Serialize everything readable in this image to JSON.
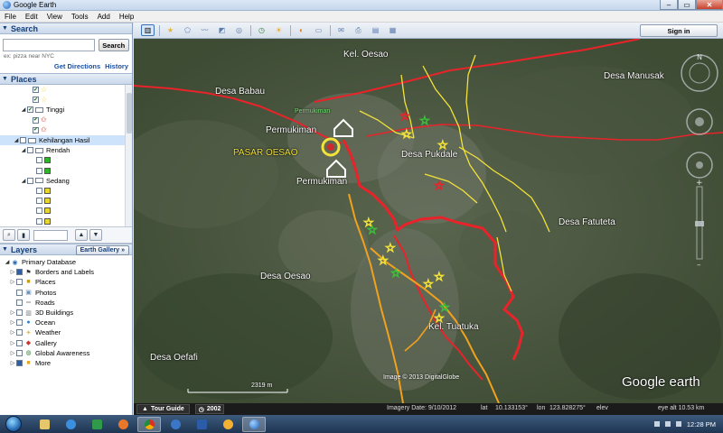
{
  "window": {
    "title": "Google Earth"
  },
  "menu": [
    "File",
    "Edit",
    "View",
    "Tools",
    "Add",
    "Help"
  ],
  "search": {
    "header": "Search",
    "placeholder": "",
    "button": "Search",
    "hint": "ex: pizza near NYC",
    "get_directions": "Get Directions",
    "history": "History"
  },
  "places": {
    "header": "Places",
    "items": [
      {
        "label": "",
        "indent": 2,
        "checked": true,
        "icon": "yellow-star-icon"
      },
      {
        "label": "",
        "indent": 2,
        "checked": true,
        "icon": "yellow-star-icon"
      },
      {
        "label": "Tinggi",
        "indent": 1,
        "checked": true,
        "icon": "folder-icon"
      },
      {
        "label": "",
        "indent": 2,
        "checked": true,
        "icon": "red-star-icon"
      },
      {
        "label": "",
        "indent": 2,
        "checked": true,
        "icon": "red-star-icon"
      },
      {
        "label": "Kehilangan Hasil",
        "indent": 0,
        "checked": false,
        "icon": "folder-icon",
        "selected": true
      },
      {
        "label": "Rendah",
        "indent": 1,
        "checked": false,
        "icon": "folder-icon"
      },
      {
        "label": "",
        "indent": 2,
        "checked": false,
        "icon": "green-square-icon"
      },
      {
        "label": "",
        "indent": 2,
        "checked": false,
        "icon": "green-square-icon"
      },
      {
        "label": "Sedang",
        "indent": 1,
        "checked": false,
        "icon": "folder-icon"
      },
      {
        "label": "",
        "indent": 2,
        "checked": false,
        "icon": "yellow-square-icon"
      },
      {
        "label": "",
        "indent": 2,
        "checked": false,
        "icon": "yellow-square-icon"
      },
      {
        "label": "",
        "indent": 2,
        "checked": false,
        "icon": "yellow-square-icon"
      },
      {
        "label": "",
        "indent": 2,
        "checked": false,
        "icon": "yellow-square-icon"
      }
    ]
  },
  "layers": {
    "header": "Layers",
    "gallery_button": "Earth Gallery",
    "items": [
      {
        "label": "Primary Database",
        "icon": "globe-icon"
      },
      {
        "label": "Borders and Labels",
        "icon": "flag-icon"
      },
      {
        "label": "Places",
        "icon": "places-icon"
      },
      {
        "label": "Photos",
        "icon": "photo-icon"
      },
      {
        "label": "Roads",
        "icon": "road-icon"
      },
      {
        "label": "3D Buildings",
        "icon": "building-icon"
      },
      {
        "label": "Ocean",
        "icon": "ocean-icon"
      },
      {
        "label": "Weather",
        "icon": "weather-icon"
      },
      {
        "label": "Gallery",
        "icon": "gallery-icon"
      },
      {
        "label": "Global Awareness",
        "icon": "awareness-icon"
      },
      {
        "label": "More",
        "icon": "more-icon"
      }
    ]
  },
  "toolbar": {
    "sign_in": "Sign in"
  },
  "map": {
    "labels": [
      {
        "text": "Kel. Oesao",
        "style": "white"
      },
      {
        "text": "Desa Babau",
        "style": "white"
      },
      {
        "text": "Permukiman",
        "style": "green"
      },
      {
        "text": "Permukiman",
        "style": "white"
      },
      {
        "text": "PASAR OESAO",
        "style": "yellow"
      },
      {
        "text": "Permukiman",
        "style": "white"
      },
      {
        "text": "Desa Manusak",
        "style": "white"
      },
      {
        "text": "Desa Pukdale",
        "style": "white"
      },
      {
        "text": "Desa Fatuteta",
        "style": "white"
      },
      {
        "text": "Desa Oesao",
        "style": "white"
      },
      {
        "text": "Kel. Tuatuka",
        "style": "white"
      },
      {
        "text": "Desa Oefafi",
        "style": "white"
      }
    ],
    "copyright": "Image © 2013 DigitalGlobe",
    "logo": "Google earth",
    "scale": "2319 m"
  },
  "status": {
    "tour_guide": "Tour Guide",
    "year": "2002",
    "imagery_date": "Imagery Date: 9/10/2012",
    "lat": "lat",
    "lat_value": "10.133153°",
    "lon": "lon",
    "lon_value": "123.828275°",
    "elev": "elev",
    "eye_alt": "eye alt 10.53 km"
  },
  "taskbar": {
    "time": "12:28 PM"
  },
  "colors": {
    "boundary_red": "#e8232a",
    "road_yellow": "#f2e23a",
    "road_orange": "#f0a21e",
    "road_red": "#e8232a"
  }
}
